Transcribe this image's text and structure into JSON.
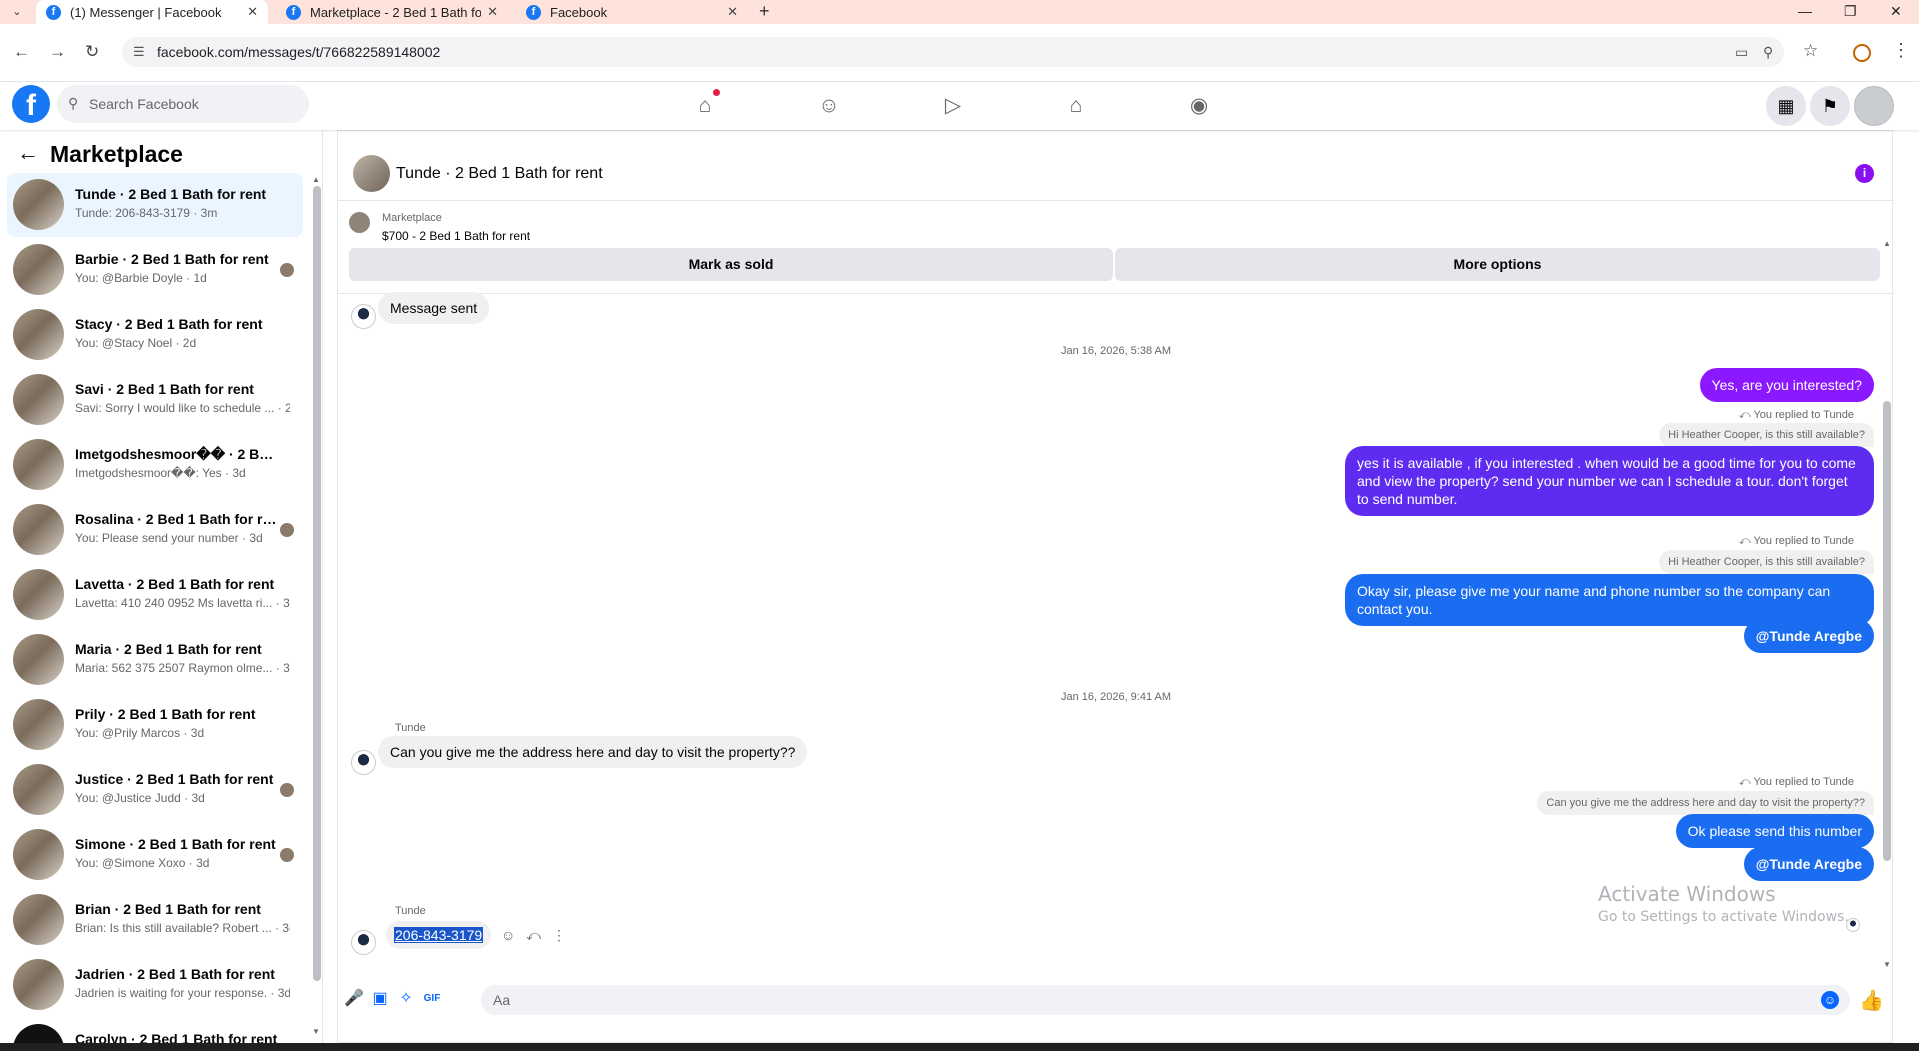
{
  "browser": {
    "tabs": [
      {
        "title": "(1) Messenger | Facebook",
        "active": true
      },
      {
        "title": "Marketplace - 2 Bed 1 Bath for",
        "active": false
      },
      {
        "title": "Facebook",
        "active": false
      }
    ],
    "url": "facebook.com/messages/t/766822589148002"
  },
  "header": {
    "search_placeholder": "Search Facebook"
  },
  "sidebar": {
    "title": "Marketplace",
    "conversations": [
      {
        "name": "Tunde · 2 Bed 1 Bath for rent",
        "preview": "Tunde: 206-843-3179 · 3m"
      },
      {
        "name": "Barbie · 2 Bed 1 Bath for rent",
        "preview": "You: @Barbie Doyle · 1d"
      },
      {
        "name": "Stacy · 2 Bed 1 Bath for rent",
        "preview": "You: @Stacy Noel · 2d"
      },
      {
        "name": "Savi · 2 Bed 1 Bath for rent",
        "preview": "Savi: Sorry I would like to schedule ... · 2d"
      },
      {
        "name": "Imetgodshesmoor�� · 2 Bed 1 ...",
        "preview": "Imetgodshesmoor��: Yes · 3d"
      },
      {
        "name": "Rosalina · 2 Bed 1 Bath for rent",
        "preview": "You: Please send your number · 3d"
      },
      {
        "name": "Lavetta · 2 Bed 1 Bath for rent",
        "preview": "Lavetta: 410 240 0952 Ms lavetta ri... · 3d"
      },
      {
        "name": "Maria · 2 Bed 1 Bath for rent",
        "preview": "Maria: 562 375 2507 Raymon olme... · 3d"
      },
      {
        "name": "Prily · 2 Bed 1 Bath for rent",
        "preview": "You: @Prily Marcos · 3d"
      },
      {
        "name": "Justice · 2 Bed 1 Bath for rent",
        "preview": "You: @Justice Judd · 3d"
      },
      {
        "name": "Simone · 2 Bed 1 Bath for rent",
        "preview": "You: @Simone Xoxo · 3d"
      },
      {
        "name": "Brian · 2 Bed 1 Bath for rent",
        "preview": "Brian: Is this still available? Robert ... · 3d"
      },
      {
        "name": "Jadrien · 2 Bed 1 Bath for rent",
        "preview": "Jadrien is waiting for your response. · 3d"
      },
      {
        "name": "Carolyn · 2 Bed 1 Bath for rent",
        "preview": ""
      }
    ]
  },
  "chat": {
    "title": "Tunde · 2 Bed 1 Bath for rent",
    "listing": {
      "source": "Marketplace",
      "title": "$700 - 2 Bed 1 Bath for rent",
      "mark_sold": "Mark as sold",
      "more_options": "More options"
    },
    "messages": {
      "sent_notice": "Message sent",
      "ts1": "Jan 16, 2026, 5:38 AM",
      "out1": "Yes, are you interested?",
      "reply_label": "You replied to Tunde",
      "quote1": "Hi Heather Cooper, is this still available?",
      "out2": "yes it is available , if you interested . when would    be  a good time for you to come and view the  property? send your number we can I schedule  a tour. don't forget to send  number.",
      "quote2": "Hi Heather Cooper, is this still available?",
      "out3": "Okay sir, please give me your name and phone number so the company can contact you.",
      "mention": "@Tunde Aregbe",
      "ts2": "Jan 16, 2026, 9:41 AM",
      "sender": "Tunde",
      "in1": "Can you give me the address here and day to visit the property??",
      "quote3": "Can you give me the address here and day to visit the property??",
      "out4": "Ok please send this number",
      "phone": "206-843-3179"
    },
    "composer_placeholder": "Aa"
  },
  "watermark": {
    "line1": "Activate Windows",
    "line2": "Go to Settings to activate Windows."
  }
}
